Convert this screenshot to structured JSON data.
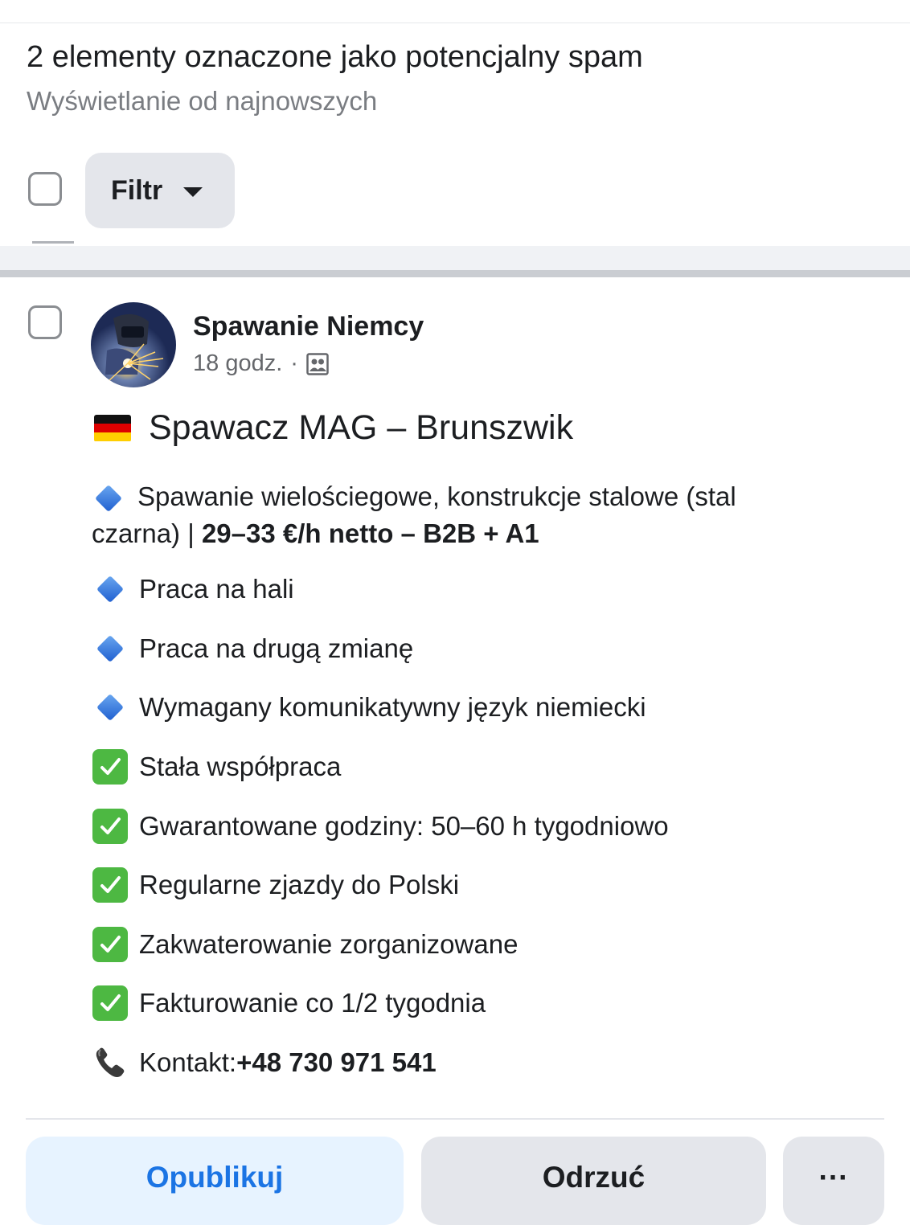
{
  "header": {
    "title": "2 elementy oznaczone jako potencjalny spam",
    "subtitle": "Wyświetlanie od najnowszych"
  },
  "toolbar": {
    "filter_label": "Filtr"
  },
  "post": {
    "author": "Spawanie Niemcy",
    "time": "18 godz.",
    "separator": "·",
    "audience_icon": "group-icon",
    "headline": "Spawacz MAG – Brunszwik",
    "headline_icon": "germany-flag-icon",
    "paragraph": {
      "text": "Spawanie wielościegowe, konstrukcje stalowe (stal czarna) | ",
      "bold": "29–33 €/h netto – B2B + A1",
      "icon": "blue-diamond-icon"
    },
    "bullets": [
      {
        "icon": "blue-diamond-icon",
        "text": "Praca na hali"
      },
      {
        "icon": "blue-diamond-icon",
        "text": "Praca na drugą zmianę"
      },
      {
        "icon": "blue-diamond-icon",
        "text": "Wymagany komunikatywny język niemiecki"
      },
      {
        "icon": "check-mark-icon",
        "text": "Stała współpraca"
      },
      {
        "icon": "check-mark-icon",
        "text": "Gwarantowane godziny: 50–60 h tygodniowo"
      },
      {
        "icon": "check-mark-icon",
        "text": "Regularne zjazdy do Polski"
      },
      {
        "icon": "check-mark-icon",
        "text": "Zakwaterowanie zorganizowane"
      },
      {
        "icon": "check-mark-icon",
        "text": "Fakturowanie co 1/2 tygodnia"
      }
    ],
    "contact": {
      "icon": "phone-icon",
      "label": "Kontakt: ",
      "number": "+48 730 971 541"
    }
  },
  "actions": {
    "publish": "Opublikuj",
    "reject": "Odrzuć",
    "more": "···"
  },
  "colors": {
    "accent": "#1b74e4",
    "accent_bg": "#e7f3ff",
    "button_bg": "#e4e6eb",
    "check_green": "#4db842"
  }
}
